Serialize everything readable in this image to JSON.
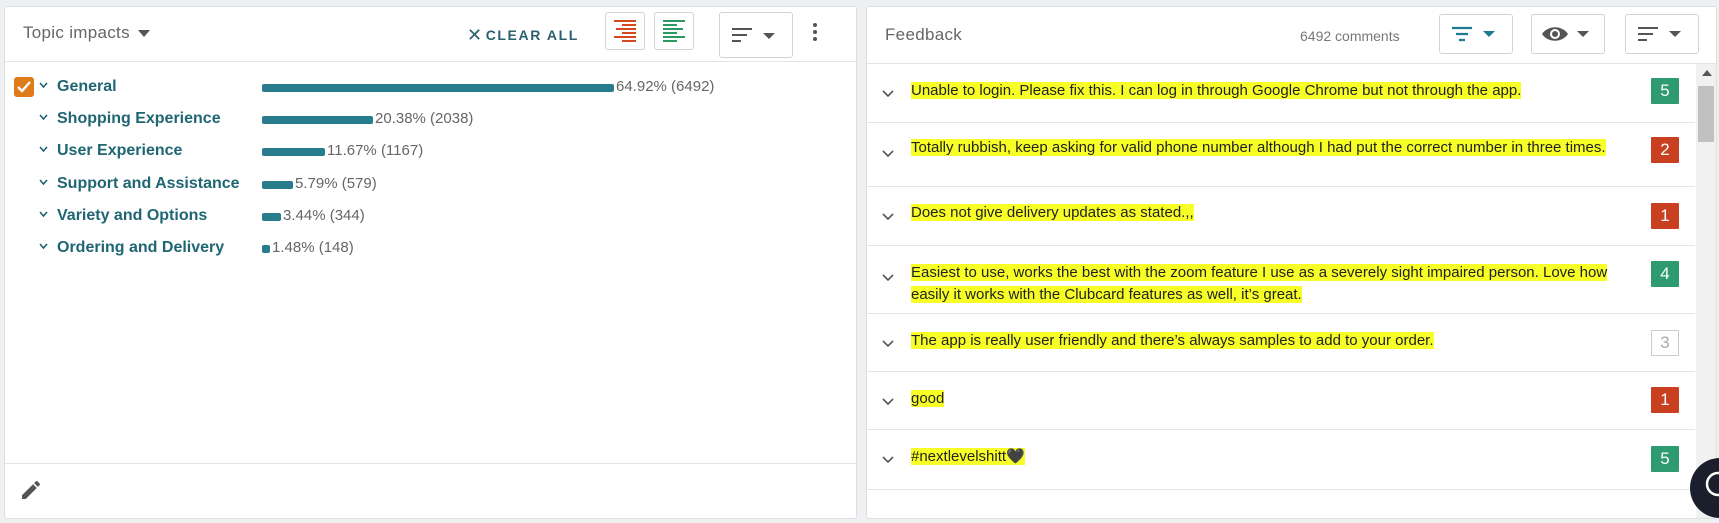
{
  "left_panel": {
    "title": "Topic impacts",
    "clear_all": "CLEAR ALL",
    "topics": [
      {
        "label": "General",
        "percent": "64.92%",
        "count": "(6492)",
        "fraction": 0.6492,
        "checked": true
      },
      {
        "label": "Shopping Experience",
        "percent": "20.38%",
        "count": "(2038)",
        "fraction": 0.2038,
        "checked": false
      },
      {
        "label": "User Experience",
        "percent": "11.67%",
        "count": "(1167)",
        "fraction": 0.1167,
        "checked": false
      },
      {
        "label": "Support and Assistance",
        "percent": "5.79%",
        "count": "(579)",
        "fraction": 0.0579,
        "checked": false
      },
      {
        "label": "Variety and Options",
        "percent": "3.44%",
        "count": "(344)",
        "fraction": 0.0344,
        "checked": false
      },
      {
        "label": "Ordering and Delivery",
        "percent": "1.48%",
        "count": "(148)",
        "fraction": 0.0148,
        "checked": false
      }
    ]
  },
  "right_panel": {
    "title": "Feedback",
    "comments_count": "6492 comments",
    "feedback": [
      {
        "text": "Unable to login. Please fix this. I can log in through Google Chrome but not through the app.",
        "score": "5",
        "score_style": "green"
      },
      {
        "text": "Totally rubbish, keep asking for valid phone number although I had put the correct number in three times.",
        "score": "2",
        "score_style": "red"
      },
      {
        "text": "Does not give delivery updates as stated.,,",
        "score": "1",
        "score_style": "red"
      },
      {
        "text": "Easiest to use, works the best with the zoom feature I use as a severely sight impaired person. Love how easily it works with the Clubcard features as well, it’s great.",
        "score": "4",
        "score_style": "green"
      },
      {
        "text": "The app is really user friendly and there’s always samples to add to your order.",
        "score": "3",
        "score_style": "grey"
      },
      {
        "text": "good",
        "score": "1",
        "score_style": "red"
      },
      {
        "text": "#nextlevelshitt🖤",
        "score": "5",
        "score_style": "green"
      }
    ]
  },
  "colors": {
    "accent_teal": "#277d8b",
    "checkbox_orange": "#e07b1a",
    "highlight_yellow": "#f8ff27",
    "score_green": "#2e9a6f",
    "score_red": "#c8401f"
  },
  "icons": [
    "caret-down-icon",
    "close-icon",
    "align-right-icon",
    "align-left-icon",
    "sort-icon",
    "kebab-icon",
    "check-icon",
    "chevron-down-icon",
    "pencil-icon",
    "filter-icon",
    "eye-icon",
    "chat-icon"
  ]
}
